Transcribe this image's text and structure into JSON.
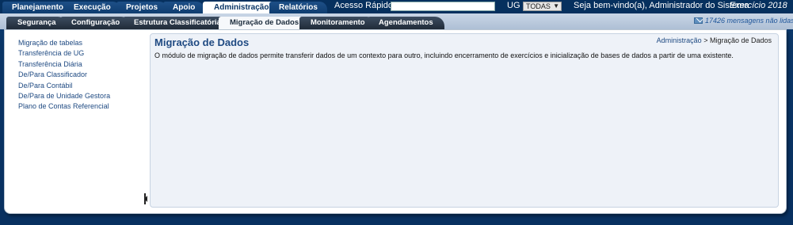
{
  "main_menu": {
    "items": [
      {
        "label": "Planejamento",
        "active": false
      },
      {
        "label": "Execução",
        "active": false
      },
      {
        "label": "Projetos",
        "active": false
      },
      {
        "label": "Apoio",
        "active": false
      },
      {
        "label": "Administração",
        "active": true
      },
      {
        "label": "Relatórios",
        "active": false
      }
    ]
  },
  "quick_access": {
    "label": "Acesso Rápido",
    "value": ""
  },
  "ug": {
    "label": "UG",
    "selected": "TODAS"
  },
  "welcome": "Seja bem-vindo(a), Administrador do Sistema",
  "exercise": "Exercício 2018",
  "sub_menu": {
    "items": [
      {
        "label": "Segurança",
        "active": false
      },
      {
        "label": "Configuração",
        "active": false
      },
      {
        "label": "Estrutura Classificatória",
        "active": false
      },
      {
        "label": "Migração de Dados",
        "active": true
      },
      {
        "label": "Monitoramento",
        "active": false
      },
      {
        "label": "Agendamentos",
        "active": false
      }
    ]
  },
  "messages": "17426 mensagens não lidas",
  "sidebar": {
    "items": [
      {
        "label": "Migração de tabelas"
      },
      {
        "label": "Transferência de UG"
      },
      {
        "label": "Transferência Diária"
      },
      {
        "label": "De/Para Classificador"
      },
      {
        "label": "De/Para Contábil"
      },
      {
        "label": "De/Para de Unidade Gestora"
      },
      {
        "label": "Plano de Contas Referencial"
      }
    ]
  },
  "page": {
    "title": "Migração de Dados",
    "breadcrumb_link": "Administração",
    "breadcrumb_separator": " > ",
    "breadcrumb_current": "Migração de Dados",
    "description": "O módulo de migração de dados permite transferir dados de um contexto para outro, incluindo encerramento de exercícios e inicialização de bases de dados a partir de uma existente."
  },
  "colors": {
    "background": "#0a3566",
    "link": "#1f4a82",
    "content_panel": "#eef2f8"
  }
}
